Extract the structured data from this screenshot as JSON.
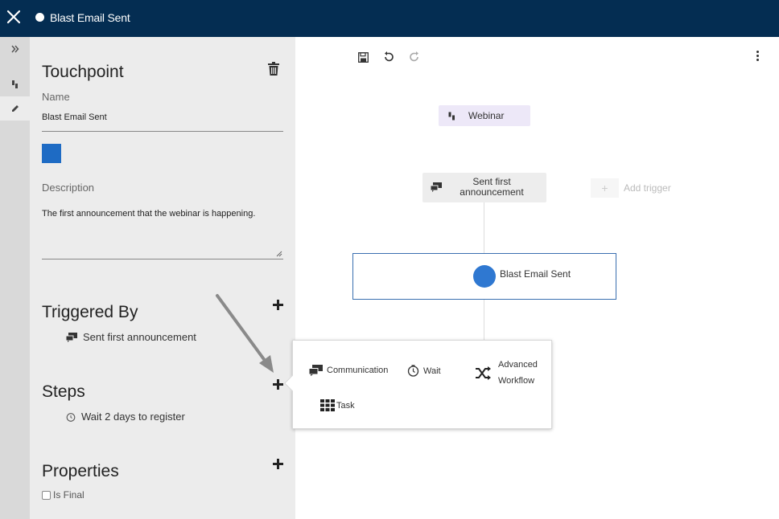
{
  "topbar": {
    "title": "Blast Email Sent",
    "close_icon": "close-icon"
  },
  "rail": {
    "items": [
      "expand-icon",
      "touchpoint-icon",
      "edit-icon"
    ]
  },
  "panel": {
    "heading": "Touchpoint",
    "name_label": "Name",
    "name_value": "Blast Email Sent",
    "color": "#1e6bc4",
    "description_label": "Description",
    "description_value": "The first announcement that the webinar is happening.",
    "triggered_by": {
      "heading": "Triggered By",
      "items": [
        "Sent first announcement"
      ]
    },
    "steps": {
      "heading": "Steps",
      "items": [
        "Wait 2 days to register"
      ]
    },
    "properties": {
      "heading": "Properties",
      "is_final_label": "Is Final",
      "is_final": false
    }
  },
  "canvas": {
    "webinar_label": "Webinar",
    "trigger_line1": "Sent first",
    "trigger_line2": "announcement",
    "add_trigger_label": "Add trigger",
    "add_trigger_symbol": "+",
    "node_label": "Blast Email Sent",
    "node_color": "#2f78d1"
  },
  "popup": {
    "communication": "Communication",
    "wait": "Wait",
    "advanced_line1": "Advanced",
    "advanced_line2": "Workflow",
    "task": "Task"
  }
}
